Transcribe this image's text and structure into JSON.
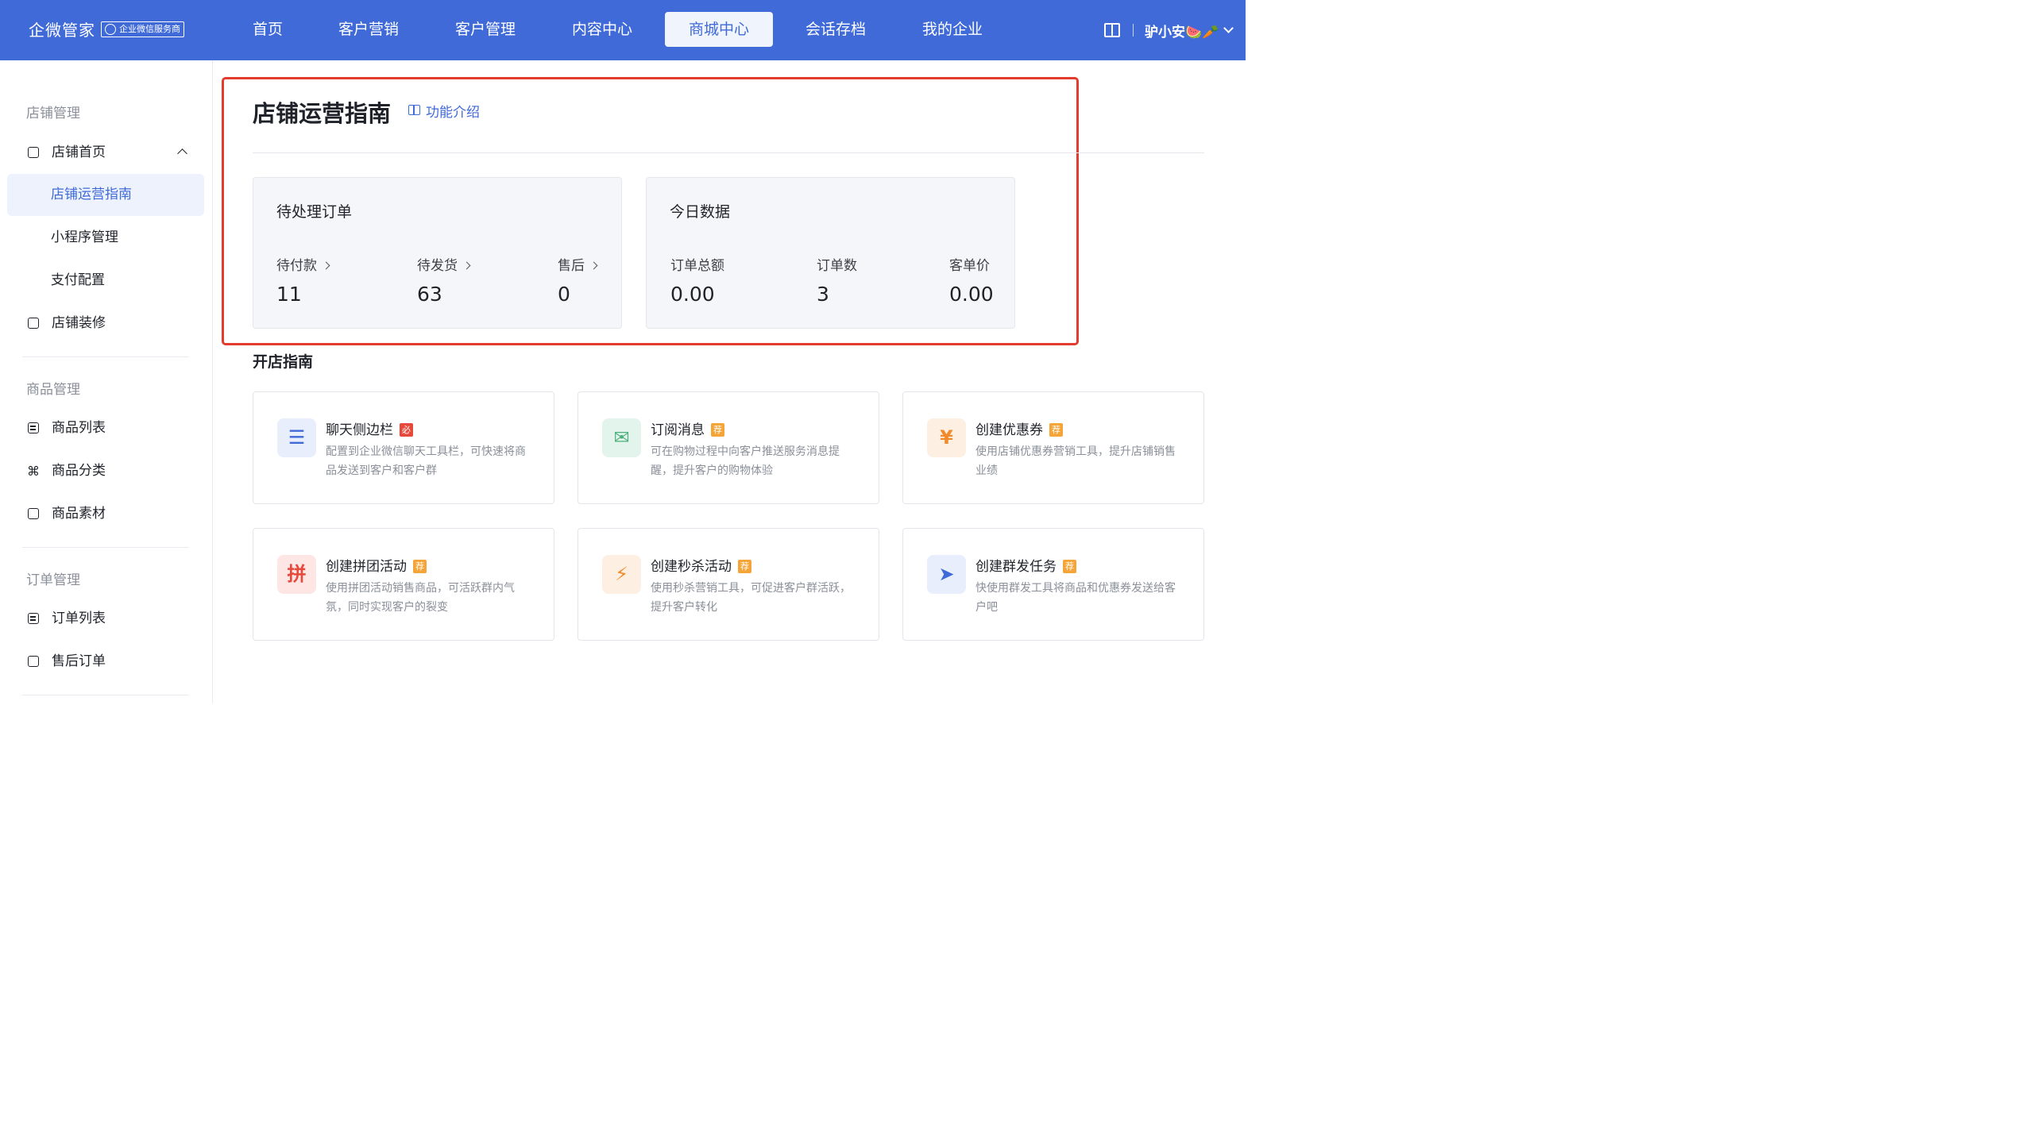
{
  "header": {
    "brand": "企微管家",
    "badge": "企业微信服务商",
    "nav": [
      "首页",
      "客户营销",
      "客户管理",
      "内容中心",
      "商城中心",
      "会话存档",
      "我的企业"
    ],
    "active_nav": "商城中心",
    "username": "驴小安🍉🥕"
  },
  "sidebar": {
    "sections": [
      {
        "title": "店铺管理",
        "items": [
          "店铺首页",
          "店铺运营指南",
          "小程序管理",
          "支付配置",
          "店铺装修"
        ]
      },
      {
        "title": "商品管理",
        "items": [
          "商品列表",
          "商品分类",
          "商品素材"
        ]
      },
      {
        "title": "订单管理",
        "items": [
          "订单列表",
          "售后订单"
        ]
      }
    ],
    "active_item": "店铺运营指南"
  },
  "main": {
    "title": "店铺运营指南",
    "intro_link": "功能介绍",
    "pending": {
      "title": "待处理订单",
      "stats": [
        {
          "label": "待付款",
          "value": "11"
        },
        {
          "label": "待发货",
          "value": "63"
        },
        {
          "label": "售后",
          "value": "0"
        }
      ]
    },
    "today": {
      "title": "今日数据",
      "stats": [
        {
          "label": "订单总额",
          "value": "0.00"
        },
        {
          "label": "订单数",
          "value": "3"
        },
        {
          "label": "客单价",
          "value": "0.00"
        }
      ]
    },
    "guide_title": "开店指南",
    "guides": [
      {
        "title": "聊天侧边栏",
        "tag": "必",
        "tag_color": "#e8483b",
        "icon": "sidebar-icon",
        "icon_bg": "#e8eefb",
        "icon_color": "#3f6ad8",
        "desc": "配置到企业微信聊天工具栏，可快速将商品发送到客户和客户群"
      },
      {
        "title": "订阅消息",
        "tag": "荐",
        "tag_color": "#f5a437",
        "icon": "subscribe-icon",
        "icon_bg": "#e2f4ec",
        "icon_color": "#4cb07a",
        "desc": "可在购物过程中向客户推送服务消息提醒，提升客户的购物体验"
      },
      {
        "title": "创建优惠券",
        "tag": "荐",
        "tag_color": "#f5a437",
        "icon": "coupon-icon",
        "icon_bg": "#fdf0e2",
        "icon_color": "#f08a2b",
        "desc": "使用店铺优惠券营销工具，提升店铺销售业绩"
      },
      {
        "title": "创建拼团活动",
        "tag": "荐",
        "tag_color": "#f5a437",
        "icon": "group-buy-icon",
        "icon_bg": "#fde6e4",
        "icon_color": "#e8483b",
        "desc": "使用拼团活动销售商品，可活跃群内气氛，同时实现客户的裂变"
      },
      {
        "title": "创建秒杀活动",
        "tag": "荐",
        "tag_color": "#f5a437",
        "icon": "flash-sale-icon",
        "icon_bg": "#fdf0e2",
        "icon_color": "#f08a2b",
        "desc": "使用秒杀营销工具，可促进客户群活跃，提升客户转化"
      },
      {
        "title": "创建群发任务",
        "tag": "荐",
        "tag_color": "#f5a437",
        "icon": "send-icon",
        "icon_bg": "#e8eefb",
        "icon_color": "#3f6ad8",
        "desc": "快使用群发工具将商品和优惠券发送给客户吧"
      }
    ]
  }
}
